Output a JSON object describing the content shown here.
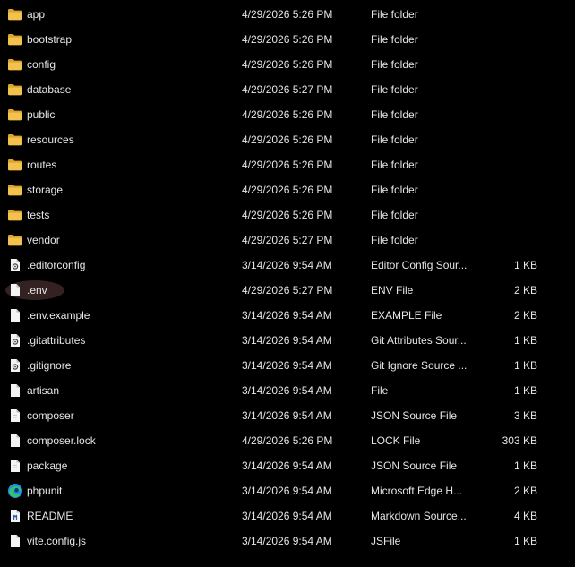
{
  "colors": {
    "background": "#000000",
    "text": "#e6e6e6",
    "folder": "#f2c14e",
    "folder_dark": "#d9a52c",
    "doc": "#f4f4f4",
    "edge_blue": "#1e90e6",
    "edge_green": "#33c26e"
  },
  "files": [
    {
      "icon": "folder-icon",
      "name": "app",
      "date": "4/29/2026 5:26 PM",
      "type": "File folder",
      "size": ""
    },
    {
      "icon": "folder-icon",
      "name": "bootstrap",
      "date": "4/29/2026 5:26 PM",
      "type": "File folder",
      "size": ""
    },
    {
      "icon": "folder-icon",
      "name": "config",
      "date": "4/29/2026 5:26 PM",
      "type": "File folder",
      "size": ""
    },
    {
      "icon": "folder-icon",
      "name": "database",
      "date": "4/29/2026 5:27 PM",
      "type": "File folder",
      "size": ""
    },
    {
      "icon": "folder-icon",
      "name": "public",
      "date": "4/29/2026 5:26 PM",
      "type": "File folder",
      "size": ""
    },
    {
      "icon": "folder-icon",
      "name": "resources",
      "date": "4/29/2026 5:26 PM",
      "type": "File folder",
      "size": ""
    },
    {
      "icon": "folder-icon",
      "name": "routes",
      "date": "4/29/2026 5:26 PM",
      "type": "File folder",
      "size": ""
    },
    {
      "icon": "folder-icon",
      "name": "storage",
      "date": "4/29/2026 5:26 PM",
      "type": "File folder",
      "size": ""
    },
    {
      "icon": "folder-icon",
      "name": "tests",
      "date": "4/29/2026 5:26 PM",
      "type": "File folder",
      "size": ""
    },
    {
      "icon": "folder-icon",
      "name": "vendor",
      "date": "4/29/2026 5:27 PM",
      "type": "File folder",
      "size": ""
    },
    {
      "icon": "gear-file-icon",
      "name": ".editorconfig",
      "date": "3/14/2026 9:54 AM",
      "type": "Editor Config Sour...",
      "size": "1 KB"
    },
    {
      "icon": "blank-file-icon",
      "name": ".env",
      "date": "4/29/2026 5:27 PM",
      "type": "ENV File",
      "size": "2 KB",
      "highlighted": true
    },
    {
      "icon": "blank-file-icon",
      "name": ".env.example",
      "date": "3/14/2026 9:54 AM",
      "type": "EXAMPLE File",
      "size": "2 KB"
    },
    {
      "icon": "gear-file-icon",
      "name": ".gitattributes",
      "date": "3/14/2026 9:54 AM",
      "type": "Git Attributes Sour...",
      "size": "1 KB"
    },
    {
      "icon": "gear-file-icon",
      "name": ".gitignore",
      "date": "3/14/2026 9:54 AM",
      "type": "Git Ignore Source ...",
      "size": "1 KB"
    },
    {
      "icon": "blank-file-icon",
      "name": "artisan",
      "date": "3/14/2026 9:54 AM",
      "type": "File",
      "size": "1 KB"
    },
    {
      "icon": "json-file-icon",
      "name": "composer",
      "date": "3/14/2026 9:54 AM",
      "type": "JSON Source File",
      "size": "3 KB"
    },
    {
      "icon": "blank-file-icon",
      "name": "composer.lock",
      "date": "4/29/2026 5:26 PM",
      "type": "LOCK File",
      "size": "303 KB"
    },
    {
      "icon": "json-file-icon",
      "name": "package",
      "date": "3/14/2026 9:54 AM",
      "type": "JSON Source File",
      "size": "1 KB"
    },
    {
      "icon": "edge-icon",
      "name": "phpunit",
      "date": "3/14/2026 9:54 AM",
      "type": "Microsoft Edge H...",
      "size": "2 KB"
    },
    {
      "icon": "markdown-file-icon",
      "name": "README",
      "date": "3/14/2026 9:54 AM",
      "type": "Markdown Source...",
      "size": "4 KB"
    },
    {
      "icon": "blank-file-icon",
      "name": "vite.config.js",
      "date": "3/14/2026 9:54 AM",
      "type": "JSFile",
      "size": "1 KB"
    }
  ]
}
